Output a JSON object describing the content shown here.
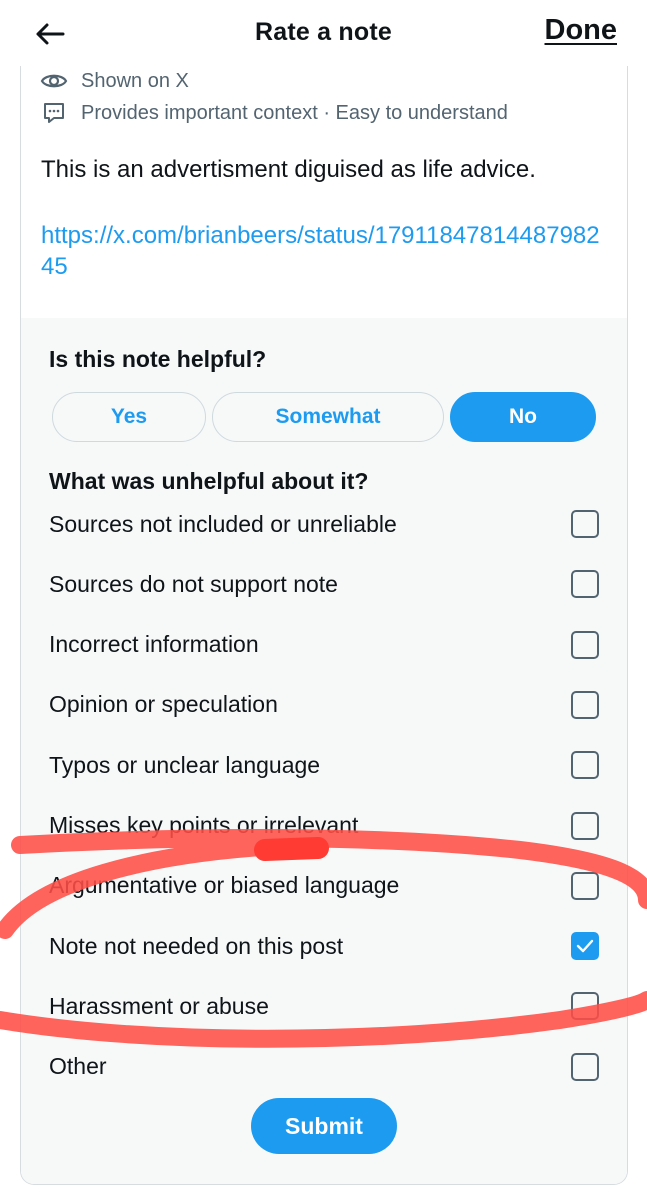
{
  "header": {
    "title": "Rate a note",
    "done_label": "Done"
  },
  "note": {
    "status": "Shown on X",
    "tags": "Provides important context · Easy to understand",
    "text": "This is an advertisment diguised as life advice.",
    "link": "https://x.com/brianbeers/status/1791184781448798245"
  },
  "rating": {
    "question": "Is this note helpful?",
    "options": [
      "Yes",
      "Somewhat",
      "No"
    ],
    "selected": "No",
    "unhelpful_question": "What was unhelpful about it?",
    "reasons": [
      {
        "label": "Sources not included or unreliable",
        "checked": false
      },
      {
        "label": "Sources do not support note",
        "checked": false
      },
      {
        "label": "Incorrect information",
        "checked": false
      },
      {
        "label": "Opinion or speculation",
        "checked": false
      },
      {
        "label": "Typos or unclear language",
        "checked": false
      },
      {
        "label": "Misses key points or irrelevant",
        "checked": false
      },
      {
        "label": "Argumentative or biased language",
        "checked": false
      },
      {
        "label": "Note not needed on this post",
        "checked": true
      },
      {
        "label": "Harassment or abuse",
        "checked": false
      },
      {
        "label": "Other",
        "checked": false
      }
    ],
    "submit_label": "Submit"
  },
  "colors": {
    "accent": "#1d9bf0",
    "annotation": "#ff4d45"
  }
}
